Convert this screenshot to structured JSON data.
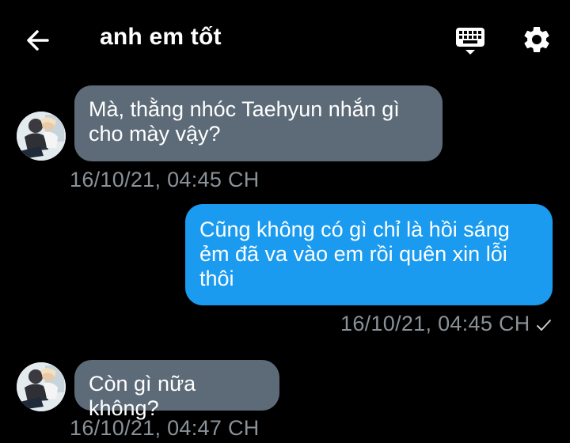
{
  "header": {
    "title": "anh em tốt",
    "back_icon": "arrow-left-icon",
    "keyboard_icon": "keyboard-icon",
    "settings_icon": "gear-icon"
  },
  "colors": {
    "background": "#000000",
    "incoming_bubble": "#5d6b78",
    "outgoing_bubble": "#1a9bf0",
    "timestamp": "#8a9299"
  },
  "messages": [
    {
      "direction": "incoming",
      "lines": [
        "Mà, thằng nhóc Taehyun nhắn gì",
        "cho mày vậy?"
      ],
      "time": "16/10/21, 04:45 CH"
    },
    {
      "direction": "outgoing",
      "lines": [
        "Cũng không có gì chỉ là hồi sáng",
        "ẻm đã va vào em rồi quên xin lỗi",
        "thôi"
      ],
      "time": "16/10/21, 04:45 CH",
      "status_icon": "check-icon"
    },
    {
      "direction": "incoming",
      "lines": [
        "Còn gì nữa không?"
      ],
      "time": "16/10/21, 04:47 CH"
    }
  ]
}
